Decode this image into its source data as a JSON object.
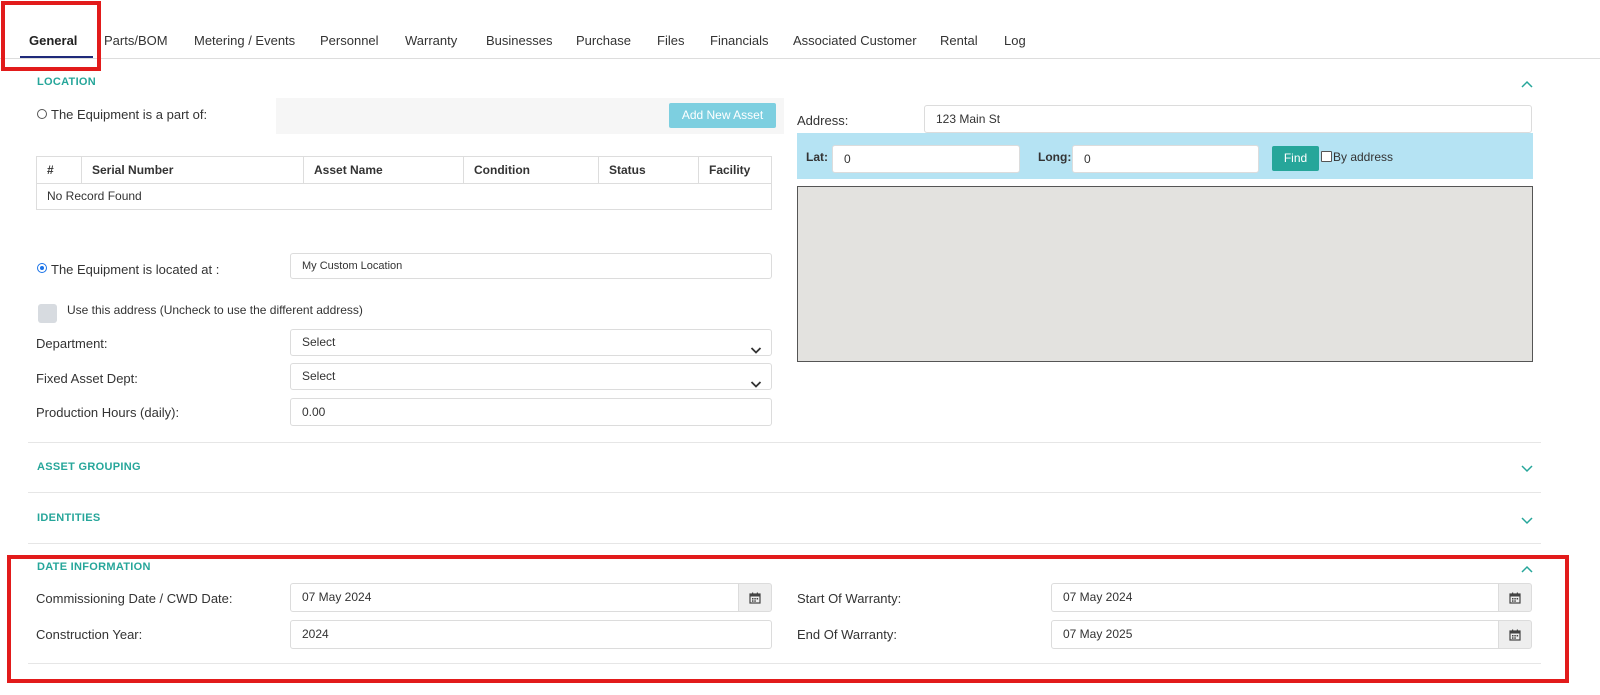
{
  "tabs": [
    {
      "label": "General",
      "active": true
    },
    {
      "label": "Parts/BOM"
    },
    {
      "label": "Metering / Events"
    },
    {
      "label": "Personnel"
    },
    {
      "label": "Warranty"
    },
    {
      "label": "Businesses"
    },
    {
      "label": "Purchase"
    },
    {
      "label": "Files"
    },
    {
      "label": "Financials"
    },
    {
      "label": "Associated Customer"
    },
    {
      "label": "Rental"
    },
    {
      "label": "Log"
    }
  ],
  "location": {
    "title": "LOCATION",
    "part_of_label": "The Equipment is a part of:",
    "add_asset_label": "Add New Asset",
    "table": {
      "columns": [
        "#",
        "Serial Number",
        "Asset Name",
        "Condition",
        "Status",
        "Facility"
      ],
      "empty_text": "No Record Found"
    },
    "located_at_label": "The Equipment is located at :",
    "located_at_value": "My Custom Location",
    "use_address_label": "Use this address (Uncheck to use the different address)",
    "department_label": "Department:",
    "department_value": "Select",
    "fixed_asset_label": "Fixed Asset Dept:",
    "fixed_asset_value": "Select",
    "production_label": "Production Hours (daily):",
    "production_value": "0.00",
    "address_label": "Address:",
    "address_value": "123 Main St",
    "lat_label": "Lat:",
    "lat_value": "0",
    "long_label": "Long:",
    "long_value": "0",
    "find_label": "Find",
    "by_address_label": "By address"
  },
  "asset_grouping": {
    "title": "ASSET GROUPING"
  },
  "identities": {
    "title": "IDENTITIES"
  },
  "date_info": {
    "title": "DATE INFORMATION",
    "commissioning_label": "Commissioning Date / CWD Date:",
    "commissioning_value": "07 May 2024",
    "construction_label": "Construction Year:",
    "construction_value": "2024",
    "start_warranty_label": "Start Of Warranty:",
    "start_warranty_value": "07 May 2024",
    "end_warranty_label": "End Of Warranty:",
    "end_warranty_value": "07 May 2025"
  },
  "colors": {
    "accent": "#26a69a",
    "tab_underline": "#1f2a7a",
    "highlight": "#e21b1b",
    "lat_bar": "#b5e3f3",
    "add_button": "#7dcfe0"
  }
}
